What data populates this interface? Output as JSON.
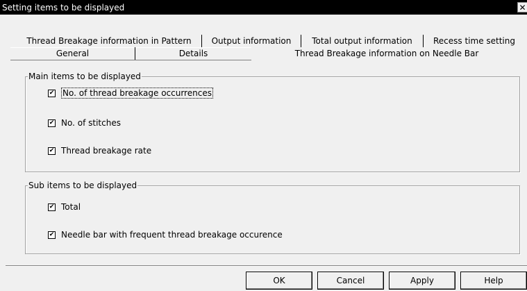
{
  "window": {
    "title": "Setting items to be displayed",
    "close_glyph": "✕"
  },
  "tabs": {
    "row1": [
      "Thread Breakage information in Pattern",
      "Output information",
      "Total output information",
      "Recess time setting"
    ],
    "row2": [
      "General",
      "Details",
      "Thread Breakage information on Needle Bar"
    ],
    "active": "Thread Breakage information on Needle Bar"
  },
  "main_group": {
    "legend": "Main items to be displayed",
    "items": [
      {
        "label": "No. of thread breakage occurrences",
        "checked": true
      },
      {
        "label": "No. of stitches",
        "checked": true
      },
      {
        "label": "Thread breakage rate",
        "checked": true
      }
    ]
  },
  "sub_group": {
    "legend": "Sub items to be displayed",
    "items": [
      {
        "label": "Total",
        "checked": true
      },
      {
        "label": "Needle bar with frequent thread breakage occurence",
        "checked": true
      }
    ]
  },
  "check_glyph": "✔",
  "buttons": {
    "ok": "OK",
    "cancel": "Cancel",
    "apply": "Apply",
    "help": "Help"
  }
}
